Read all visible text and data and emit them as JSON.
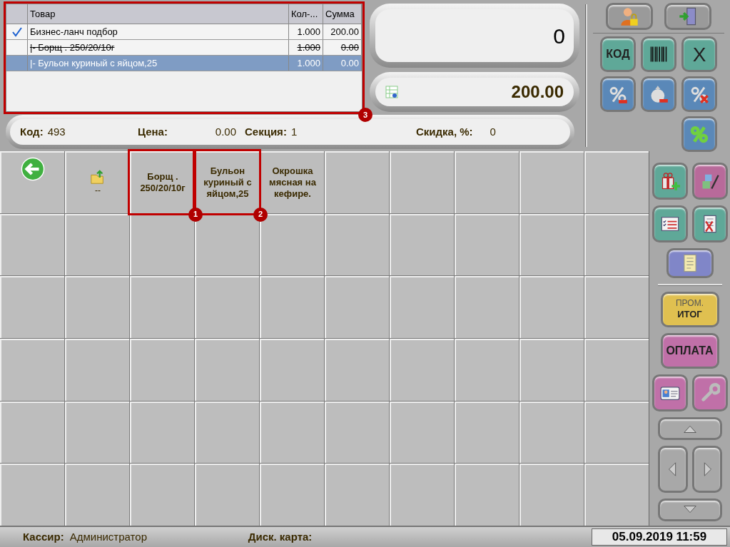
{
  "order_table": {
    "callout": "3",
    "columns": [
      "Товар",
      "Кол-...",
      "Сумма"
    ],
    "rows": [
      {
        "name": "Бизнес-ланч подбор",
        "qty": "1.000",
        "sum": "200.00",
        "checked": true,
        "struck_out": false,
        "selected": false
      },
      {
        "name": "|- Борщ . 250/20/10г",
        "qty": "1.000",
        "sum": "0.00",
        "checked": false,
        "struck_out": true,
        "selected": false
      },
      {
        "name": "|- Бульон куриный с яйцом,25",
        "qty": "1.000",
        "sum": "0.00",
        "checked": false,
        "struck_out": false,
        "selected": true
      }
    ]
  },
  "amount_display": {
    "value": "0"
  },
  "total_display": {
    "value": "200.00"
  },
  "info_bar": [
    {
      "label": "Код:",
      "value": "493"
    },
    {
      "label": "Цена:",
      "value": "0.00"
    },
    {
      "label": "Секция:",
      "value": "1"
    },
    {
      "label": "Скидка, %:",
      "value": "0"
    }
  ],
  "top_panel": {
    "buttons": [
      {
        "color": "#9a9a9a"
      },
      {
        "color": "#9a9a9a"
      },
      {
        "label": "КОД",
        "color": "#5fa898"
      },
      {
        "color": "#5fa898"
      },
      {
        "label": "X",
        "color": "#5fa898"
      },
      {
        "color": "#5a88b8"
      },
      {
        "color": "#5a88b8"
      },
      {
        "color": "#5a88b8"
      },
      {
        "color": "#5a88b8"
      }
    ]
  },
  "tiles": [
    {
      "kind": "back"
    },
    {
      "kind": "folder",
      "label": "--"
    },
    {
      "kind": "product",
      "label": "Борщ . 250/20/10г",
      "callout": "1"
    },
    {
      "kind": "product",
      "label": "Бульон куриный с яйцом,25",
      "callout": "2"
    },
    {
      "kind": "product",
      "label": "Окрошка мясная на кефире."
    }
  ],
  "side_panel": {
    "buttons": [
      {
        "color": "#5fa898"
      },
      {
        "color": "#b86a9a"
      },
      {
        "color": "#5fa898"
      },
      {
        "color": "#5fa898"
      },
      {
        "color": "#8086c8"
      },
      {
        "label": "ПРОМ.",
        "label2": "ИТОГ",
        "color": "#e0c050"
      },
      {
        "label": "ОПЛАТА",
        "color": "#c070a8"
      },
      {
        "color": "#c070a8"
      },
      {
        "color": "#c070a8"
      },
      {
        "color": "#a8a8a8"
      },
      {
        "color": "#a8a8a8"
      },
      {
        "color": "#a8a8a8"
      },
      {
        "color": "#a8a8a8"
      }
    ]
  },
  "status_bar": {
    "cashier_label": "Кассир:",
    "cashier": "Администратор",
    "card_label": "Диск. карта:",
    "datetime": "05.09.2019 11:59"
  }
}
